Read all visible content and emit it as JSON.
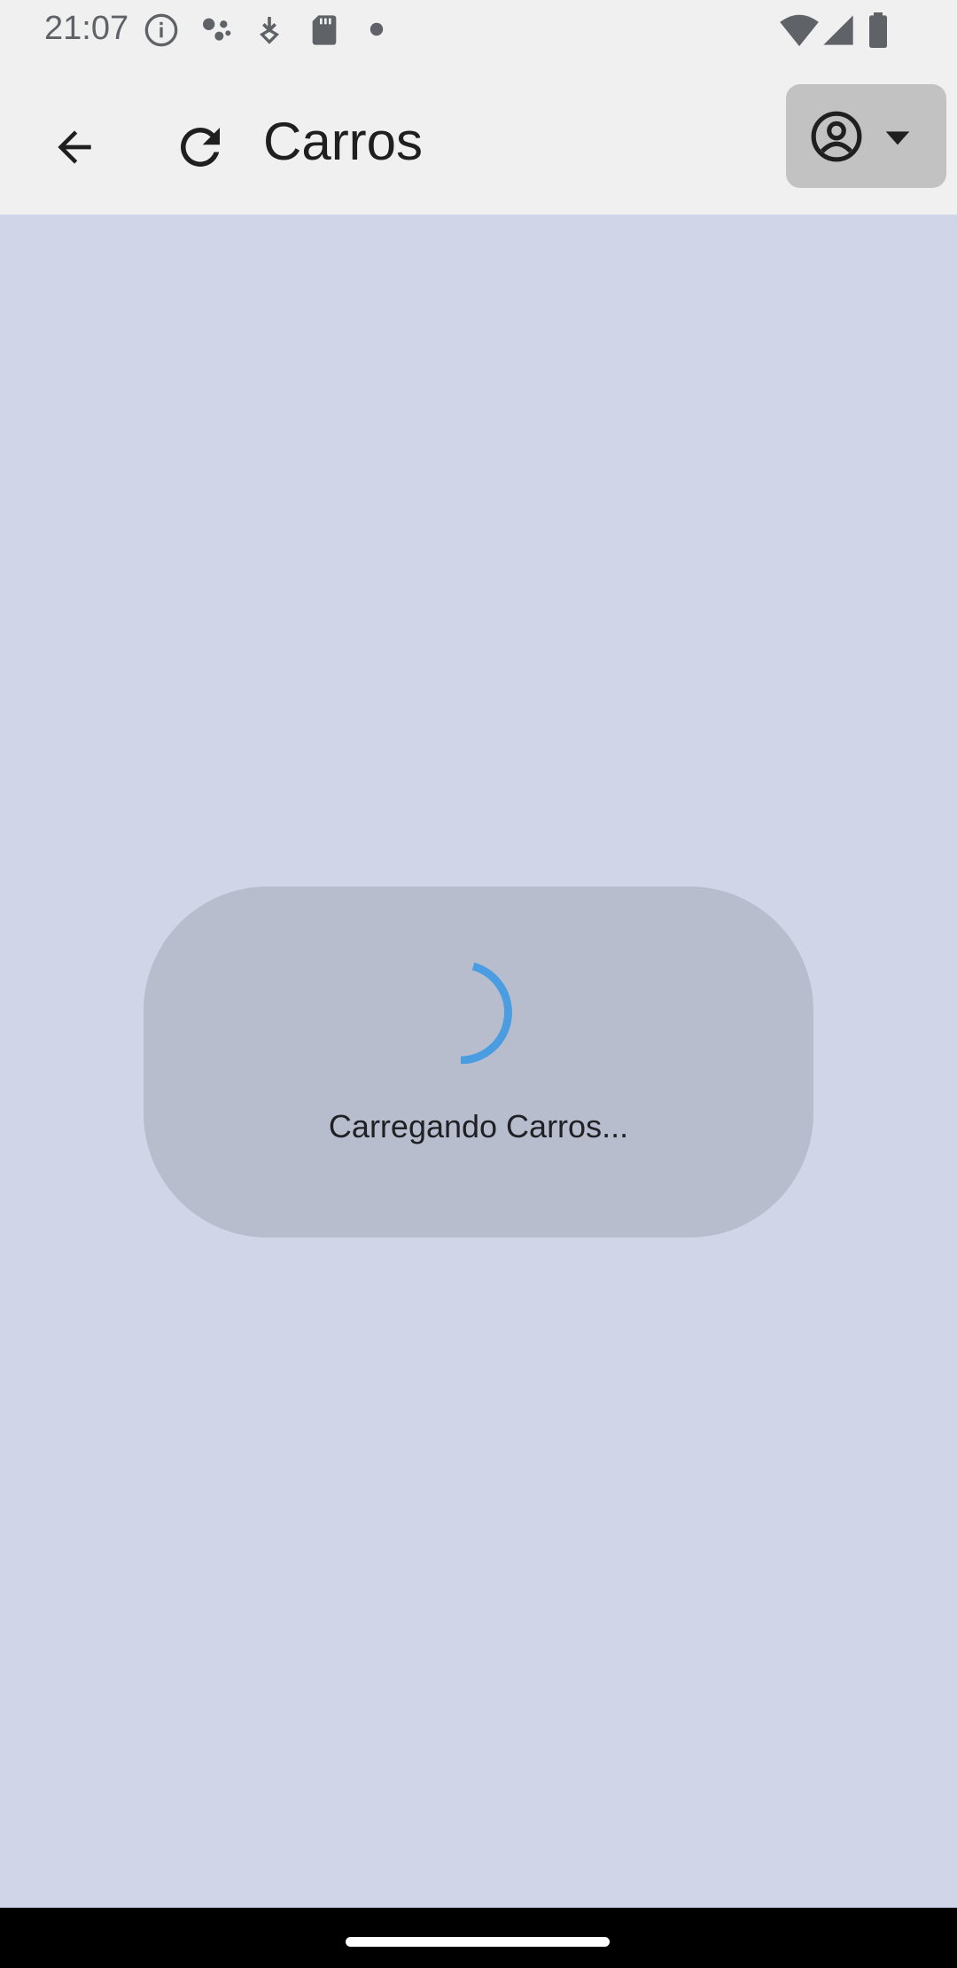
{
  "status_bar": {
    "time": "21:07",
    "icons": [
      "info-icon",
      "assistant-dots-icon",
      "download-icon",
      "sd-card-icon",
      "dot-icon",
      "wifi-icon",
      "signal-icon",
      "battery-icon"
    ]
  },
  "app_bar": {
    "title": "Carros",
    "back_icon": "arrow-back-icon",
    "refresh_icon": "refresh-icon",
    "account_icon": "account-circle-icon",
    "dropdown_icon": "caret-down-icon"
  },
  "loading": {
    "message": "Carregando Carros...",
    "spinner_color": "#4a9de0"
  },
  "colors": {
    "app_bar_bg": "#f0f0f0",
    "content_bg": "#d0d5e8",
    "card_bg": "#b8bdce",
    "account_button_bg": "#c2c2c2"
  }
}
